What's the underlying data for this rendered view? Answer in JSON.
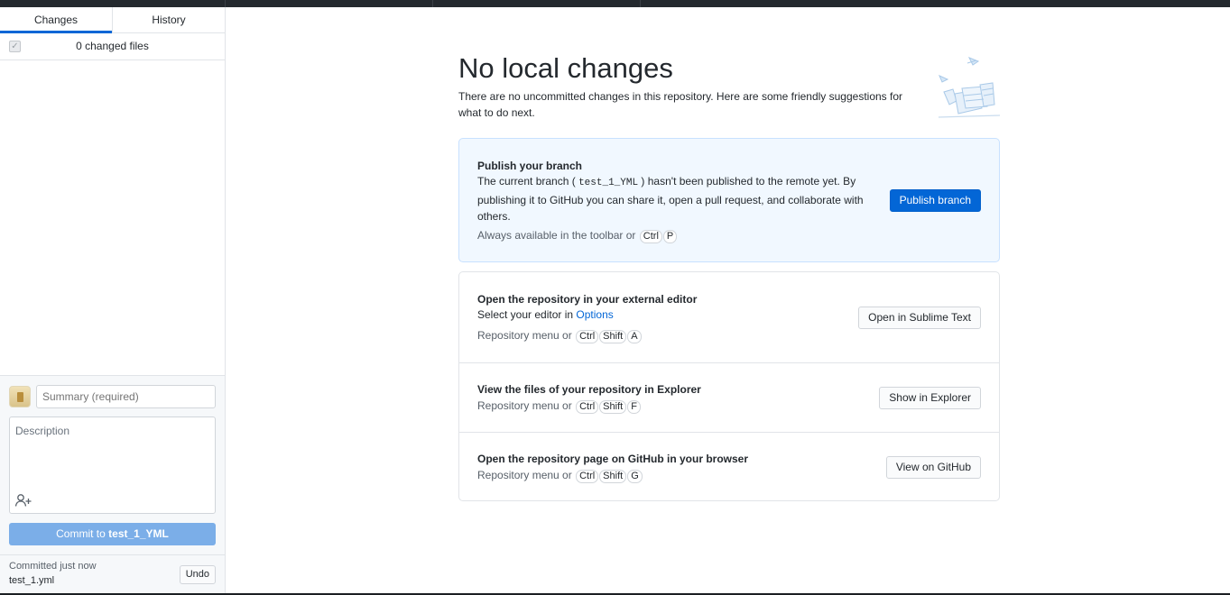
{
  "sidebar": {
    "tabs": [
      {
        "label": "Changes"
      },
      {
        "label": "History"
      }
    ],
    "changed_files_label": "0 changed files",
    "summary_placeholder": "Summary (required)",
    "description_placeholder": "Description",
    "commit_button": {
      "prefix": "Commit to ",
      "branch": "test_1_YML"
    },
    "last_commit": {
      "time": "Committed just now",
      "message": "test_1.yml",
      "undo_label": "Undo"
    }
  },
  "main": {
    "title": "No local changes",
    "subtitle": "There are no uncommitted changes in this repository. Here are some friendly suggestions for what to do next.",
    "publish": {
      "heading": "Publish your branch",
      "text_before": "The current branch (",
      "branch": "test_1_YML",
      "text_after": ") hasn't been published to the remote yet. By publishing it to GitHub you can share it, open a pull request, and collaborate with others.",
      "hint": "Always available in the toolbar or",
      "keys": [
        "Ctrl",
        "P"
      ],
      "button": "Publish branch"
    },
    "editor": {
      "heading": "Open the repository in your external editor",
      "text": "Select your editor in",
      "link": "Options",
      "hint": "Repository menu or",
      "keys": [
        "Ctrl",
        "Shift",
        "A"
      ],
      "button": "Open in Sublime Text"
    },
    "explorer": {
      "heading": "View the files of your repository in Explorer",
      "hint": "Repository menu or",
      "keys": [
        "Ctrl",
        "Shift",
        "F"
      ],
      "button": "Show in Explorer"
    },
    "github": {
      "heading": "Open the repository page on GitHub in your browser",
      "hint": "Repository menu or",
      "keys": [
        "Ctrl",
        "Shift",
        "G"
      ],
      "button": "View on GitHub"
    }
  },
  "colors": {
    "accent": "#0366d6",
    "commit_button": "#7baee8",
    "publish_card_bg": "#f1f8ff"
  }
}
